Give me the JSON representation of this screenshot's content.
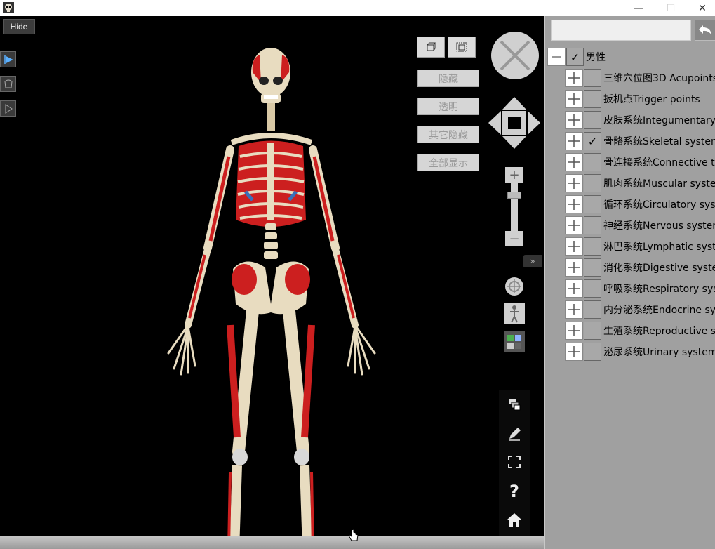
{
  "window": {
    "minimize_glyph": "—",
    "maximize_glyph": "☐",
    "close_glyph": "✕"
  },
  "viewport": {
    "hide_label": "Hide",
    "buttons": {
      "hide": "隐藏",
      "transparent": "透明",
      "hide_others": "其它隐藏",
      "show_all": "全部显示"
    },
    "help_glyph": "?",
    "zoom_in": "+",
    "zoom_out": "−",
    "collapse_glyph": "»"
  },
  "tree": {
    "search": {
      "value": "",
      "placeholder": ""
    },
    "root": {
      "label": "男性",
      "checked": true,
      "check_glyph": "✓",
      "expander": "—"
    },
    "items": [
      {
        "label": "三维穴位图3D Acupoints",
        "checked": false
      },
      {
        "label": "扳机点Trigger points",
        "checked": false
      },
      {
        "label": "皮肤系统Integumentary system",
        "checked": false
      },
      {
        "label": "骨骼系统Skeletal system",
        "checked": true
      },
      {
        "label": "骨连接系统Connective tissue",
        "checked": false
      },
      {
        "label": "肌肉系统Muscular system",
        "checked": false
      },
      {
        "label": "循环系统Circulatory system",
        "checked": false
      },
      {
        "label": "神经系统Nervous system",
        "checked": false
      },
      {
        "label": "淋巴系统Lymphatic system",
        "checked": false
      },
      {
        "label": "消化系统Digestive system",
        "checked": false
      },
      {
        "label": "呼吸系统Respiratory system",
        "checked": false
      },
      {
        "label": "内分泌系统Endocrine system",
        "checked": false
      },
      {
        "label": "生殖系统Reproductive system",
        "checked": false
      },
      {
        "label": "泌尿系统Urinary system",
        "checked": false
      }
    ]
  },
  "colors": {
    "background": "#000000",
    "panel": "#a0a0a0",
    "bone": "#e8dcc0",
    "muscle": "#cc1f1f",
    "cartilage": "#3a6fb8"
  }
}
